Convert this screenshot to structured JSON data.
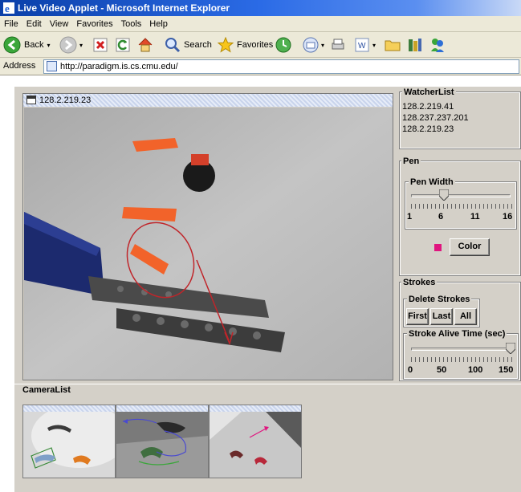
{
  "window": {
    "title": "Live Video Applet - Microsoft Internet Explorer"
  },
  "menu": [
    "File",
    "Edit",
    "View",
    "Favorites",
    "Tools",
    "Help"
  ],
  "toolbar": {
    "back": "Back",
    "search": "Search",
    "favorites": "Favorites"
  },
  "address": {
    "label": "Address",
    "url": "http://paradigm.is.cs.cmu.edu/"
  },
  "video": {
    "title": "128.2.219.23"
  },
  "watcher": {
    "title": "WatcherList",
    "items": [
      "128.2.219.41",
      "128.237.237.201",
      "128.2.219.23"
    ]
  },
  "pen": {
    "title": "Pen",
    "width_label": "Pen Width",
    "ticks": [
      "1",
      "6",
      "11",
      "16"
    ],
    "width_value": 6,
    "color_label": "Color",
    "color": "#e0157f"
  },
  "strokes": {
    "title": "Strokes",
    "delete_label": "Delete Strokes",
    "first": "First",
    "last": "Last",
    "all": "All",
    "alive_label": "Stroke Alive Time (sec)",
    "ticks": [
      "0",
      "50",
      "100",
      "150"
    ],
    "alive_value": 150
  },
  "cameras": {
    "title": "CameraList"
  }
}
